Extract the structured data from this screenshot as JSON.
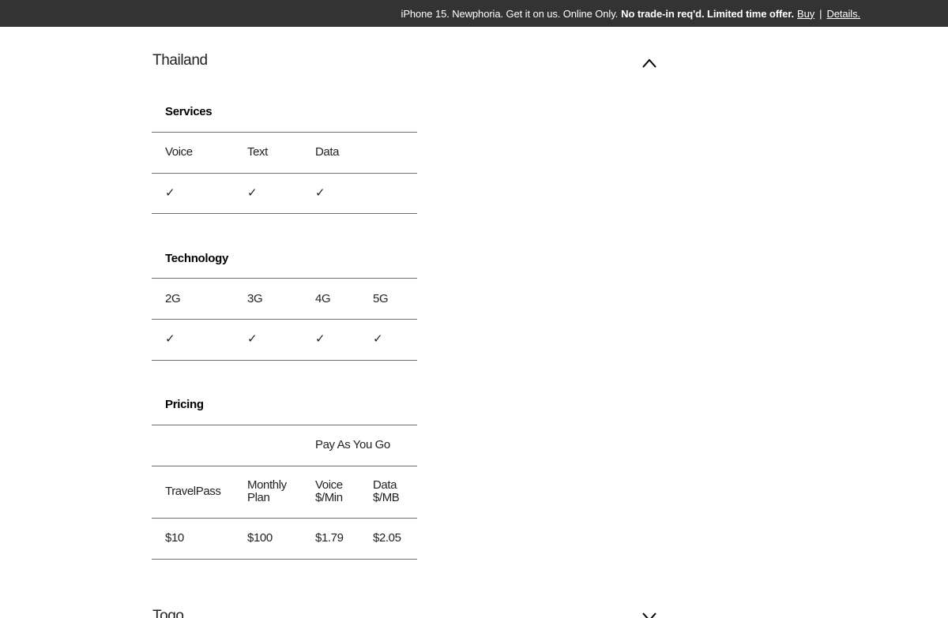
{
  "promo": {
    "text": "iPhone 15. Newphoria. Get it on us. Online Only.",
    "bold_text": "No trade-in req'd. Limited time offer.",
    "buy_link": "Buy",
    "separator": "|",
    "details_link": "Details."
  },
  "country": {
    "name": "Thailand",
    "next_name": "Togo"
  },
  "services": {
    "title": "Services",
    "headers": [
      "Voice",
      "Text",
      "Data"
    ],
    "values": [
      "✓",
      "✓",
      "✓"
    ]
  },
  "technology": {
    "title": "Technology",
    "headers": [
      "2G",
      "3G",
      "4G",
      "5G"
    ],
    "values": [
      "✓",
      "✓",
      "✓",
      "✓"
    ]
  },
  "pricing": {
    "title": "Pricing",
    "group_label": "Pay As You Go",
    "headers": [
      {
        "line1": "TravelPass",
        "line2": ""
      },
      {
        "line1": "Monthly",
        "line2": "Plan"
      },
      {
        "line1": "Voice",
        "line2": "$/Min"
      },
      {
        "line1": "Data",
        "line2": "$/MB"
      }
    ],
    "values": [
      "$10",
      "$100",
      "$1.79",
      "$2.05"
    ]
  }
}
